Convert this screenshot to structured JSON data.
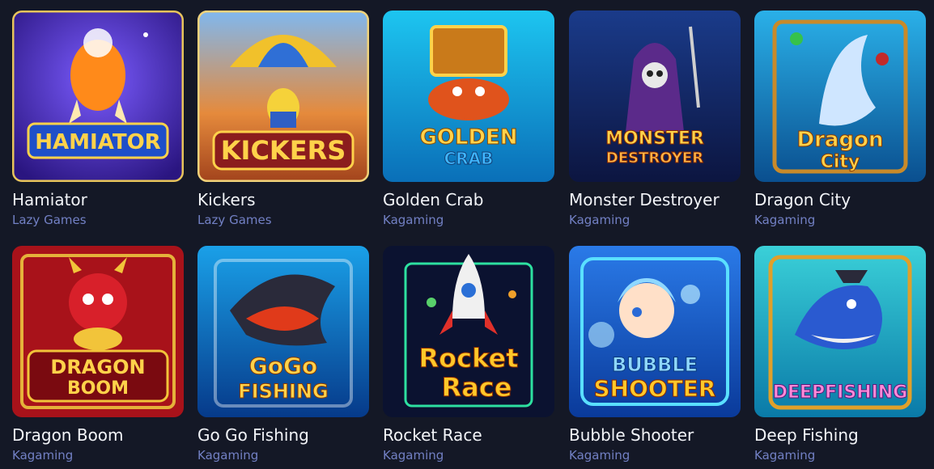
{
  "games": [
    {
      "title": "Hamiator",
      "provider": "Lazy Games",
      "logo": "HAMIATOR",
      "logo2": ""
    },
    {
      "title": "Kickers",
      "provider": "Lazy Games",
      "logo": "KICKERS",
      "logo2": ""
    },
    {
      "title": "Golden Crab",
      "provider": "Kagaming",
      "logo": "GOLDEN",
      "logo2": "CRAB"
    },
    {
      "title": "Monster Destroyer",
      "provider": "Kagaming",
      "logo": "MONSTER",
      "logo2": "DESTROYER"
    },
    {
      "title": "Dragon City",
      "provider": "Kagaming",
      "logo": "Dragon",
      "logo2": "City"
    },
    {
      "title": "Dragon Boom",
      "provider": "Kagaming",
      "logo": "DRAGON",
      "logo2": "BOOM"
    },
    {
      "title": "Go Go Fishing",
      "provider": "Kagaming",
      "logo": "GoGo",
      "logo2": "FISHING"
    },
    {
      "title": "Rocket Race",
      "provider": "Kagaming",
      "logo": "Rocket",
      "logo2": "Race"
    },
    {
      "title": "Bubble Shooter",
      "provider": "Kagaming",
      "logo": "BUBBLE",
      "logo2": "SHOOTER"
    },
    {
      "title": "Deep Fishing",
      "provider": "Kagaming",
      "logo": "DEEPFISHING",
      "logo2": ""
    }
  ],
  "colors": {
    "background": "#141826",
    "title": "#f2f4f8",
    "provider": "#7280c4"
  }
}
